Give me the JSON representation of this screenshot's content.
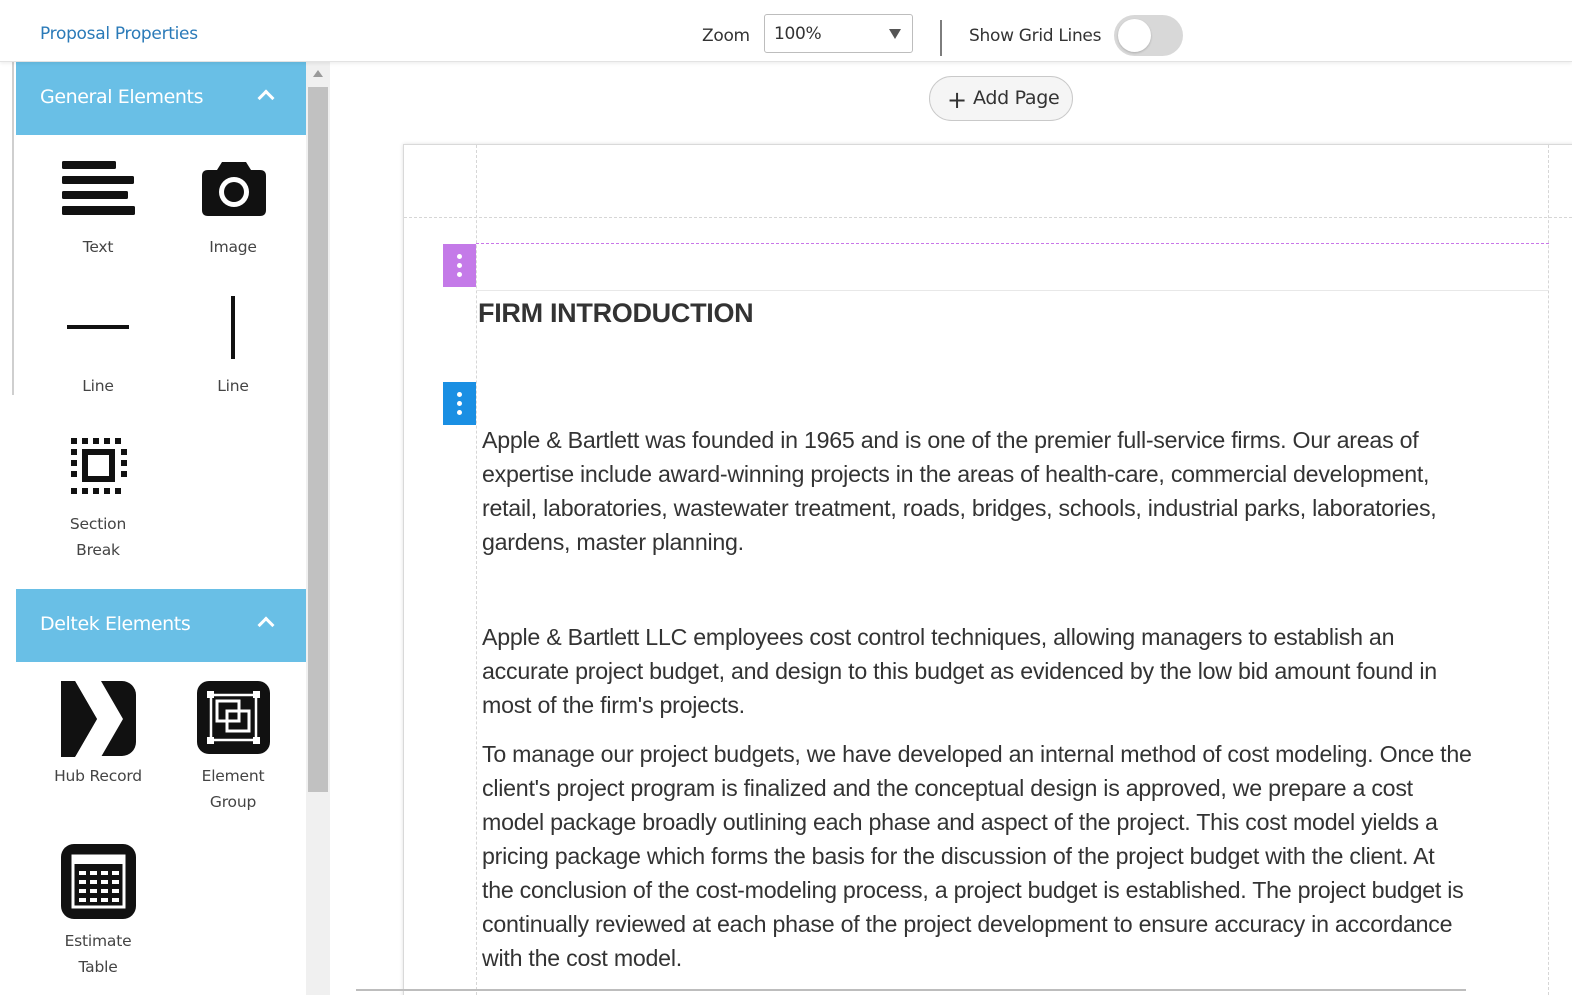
{
  "header": {
    "proposal_properties_link": "Proposal Properties",
    "zoom_label": "Zoom",
    "zoom_value": "100%",
    "grid_lines_label": "Show Grid Lines",
    "grid_lines_on": false
  },
  "sidebar": {
    "general": {
      "title": "General Elements",
      "items": [
        {
          "label": "Text",
          "icon": "text-align-icon"
        },
        {
          "label": "Image",
          "icon": "camera-icon"
        },
        {
          "label": "Line",
          "icon": "horizontal-line-icon"
        },
        {
          "label": "Line",
          "icon": "vertical-line-icon"
        },
        {
          "label": "Section\nBreak",
          "icon": "section-break-icon"
        }
      ]
    },
    "deltek": {
      "title": "Deltek Elements",
      "items": [
        {
          "label": "Hub Record",
          "icon": "hub-record-icon"
        },
        {
          "label": "Element\nGroup",
          "icon": "element-group-icon"
        },
        {
          "label": "Estimate\nTable",
          "icon": "estimate-table-icon"
        }
      ]
    }
  },
  "canvas": {
    "add_page_label": "Add Page",
    "heading": "FIRM INTRODUCTION",
    "paragraphs": [
      "Apple & Bartlett was founded in 1965 and is one of the premier full-service firms.  Our areas of\nexpertise include award-winning projects in the areas of health-care, commercial development,\nretail, laboratories, wastewater treatment, roads, bridges, schools, industrial parks, laboratories,\ngardens, master planning.",
      "Apple & Bartlett LLC employees cost control techniques, allowing managers to establish an\naccurate project budget, and design to this budget as evidenced by the low bid amount found in\nmost of the firm's projects.",
      "To manage our project budgets, we have developed an internal method of cost modeling.  Once the\nclient's project program is finalized and the conceptual design is approved, we prepare a cost\nmodel package broadly outlining each phase and aspect of the project.  This cost model yields a\npricing package which forms the basis for the discussion of the project budget with the client.  At\nthe conclusion of the cost-modeling process, a project budget is established. The project budget is\ncontinually reviewed at each phase of the project development to ensure accuracy in accordance\nwith the cost model."
    ]
  },
  "colors": {
    "accent_header": "#69bfe6",
    "link": "#2a7ab8",
    "handle_purple": "#c47ae8",
    "handle_blue": "#1a8fe3"
  }
}
